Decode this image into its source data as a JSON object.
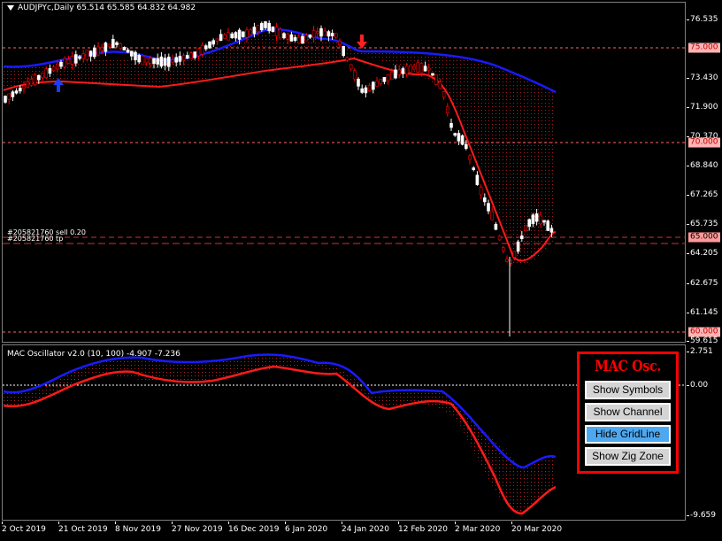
{
  "header": {
    "text": "AUDJPYc,Daily  65.514 65.585 64.832 64.982"
  },
  "orders": {
    "sell": "#205821760 sell 0.20",
    "tp": "#205821760 tp"
  },
  "price_axis": {
    "ticks": [
      "76.535",
      "75.000",
      "73.430",
      "71.900",
      "70.370",
      "68.840",
      "67.265",
      "65.735",
      "64.205",
      "62.675",
      "61.145",
      "59.615"
    ],
    "current_price": "65.000",
    "levels": [
      "75.000",
      "70.000",
      "60.000"
    ]
  },
  "oscillator": {
    "title": "MAC Oscillator v2.0 (10, 100) -4.907 -7.236",
    "ticks": [
      "2.751",
      "0.00",
      "-9.659"
    ]
  },
  "time_axis": [
    "2 Oct 2019",
    "21 Oct 2019",
    "8 Nov 2019",
    "27 Nov 2019",
    "16 Dec 2019",
    "6 Jan 2020",
    "24 Jan 2020",
    "12 Feb 2020",
    "2 Mar 2020",
    "20 Mar 2020"
  ],
  "mac_panel": {
    "title": "MAC Osc.",
    "buttons": [
      "Show Symbols",
      "Show Channel",
      "Hide GridLine",
      "Show Zig Zone"
    ]
  },
  "colors": {
    "bull": "#ffffff",
    "bear": "#ff0000",
    "upper_line": "#0000ff",
    "lower_line": "#ff0000",
    "level": "#ff6666",
    "panel_border": "#ff0000",
    "active_button": "#4ea8f0"
  },
  "icons": {
    "up_signal": "up-arrow-icon",
    "down_signal": "down-arrow-icon"
  }
}
